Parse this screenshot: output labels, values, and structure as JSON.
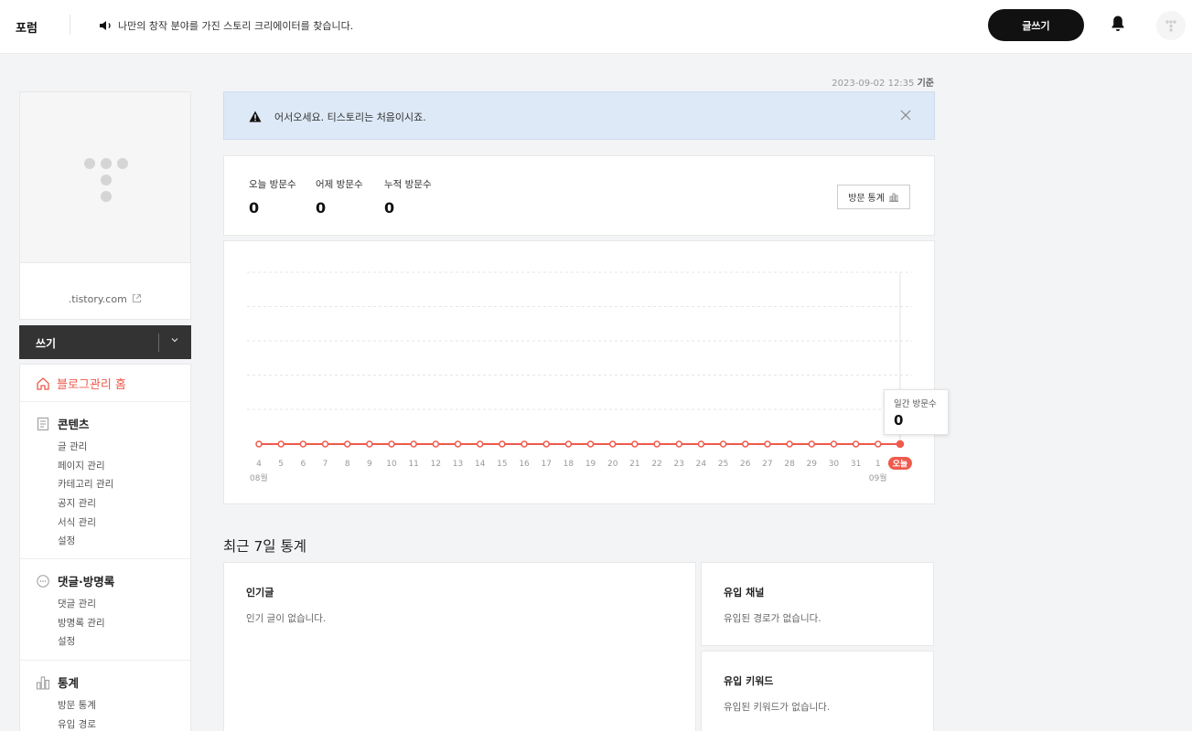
{
  "header": {
    "brand": "포럼",
    "notice": "나만의 창작 분야를 가진 스토리 크리에이터를 찾습니다.",
    "write_button": "글쓰기"
  },
  "sidebar": {
    "blog_url": ".tistory.com",
    "write_menu_label": "쓰기",
    "home_label": "블로그관리 홈",
    "sections": [
      {
        "title": "콘텐츠",
        "icon": "document-icon",
        "items": [
          "글 관리",
          "페이지 관리",
          "카테고리 관리",
          "공지 관리",
          "서식 관리",
          "설정"
        ]
      },
      {
        "title": "댓글·방명록",
        "icon": "speech-bubble-icon",
        "items": [
          "댓글 관리",
          "방명록 관리",
          "설정"
        ]
      },
      {
        "title": "통계",
        "icon": "bar-chart-icon",
        "items": [
          "방문 통계",
          "유입 경로"
        ]
      }
    ]
  },
  "main": {
    "timestamp": "2023-09-02 12:35",
    "timestamp_suffix": "기준",
    "alert_message": "어서오세요. 티스토리는 처음이시죠.",
    "stats": [
      {
        "label": "오늘 방문수",
        "value": "0"
      },
      {
        "label": "어제 방문수",
        "value": "0"
      },
      {
        "label": "누적 방문수",
        "value": "0"
      }
    ],
    "stats_button": "방문 통계",
    "tooltip_label": "일간 방문수",
    "tooltip_value": "0",
    "recent_title": "최근 7일 통계",
    "cards": [
      {
        "title": "인기글",
        "desc": "인기 글이 없습니다."
      },
      {
        "title": "유입 채널",
        "desc": "유입된 경로가 없습니다."
      },
      {
        "title": "유입 키워드",
        "desc": "유입된 키워드가 없습니다."
      }
    ]
  },
  "colors": {
    "accent": "#ee5a4c",
    "alert_bg": "#dde9f6",
    "dark": "#333333"
  },
  "chart_data": {
    "type": "line",
    "x": [
      "4",
      "5",
      "6",
      "7",
      "8",
      "9",
      "10",
      "11",
      "12",
      "13",
      "14",
      "15",
      "16",
      "17",
      "18",
      "19",
      "20",
      "21",
      "22",
      "23",
      "24",
      "25",
      "26",
      "27",
      "28",
      "29",
      "30",
      "31",
      "1",
      "오늘"
    ],
    "values": [
      0,
      0,
      0,
      0,
      0,
      0,
      0,
      0,
      0,
      0,
      0,
      0,
      0,
      0,
      0,
      0,
      0,
      0,
      0,
      0,
      0,
      0,
      0,
      0,
      0,
      0,
      0,
      0,
      0,
      0
    ],
    "month_labels": [
      "08월",
      "09월"
    ],
    "grid": true
  }
}
